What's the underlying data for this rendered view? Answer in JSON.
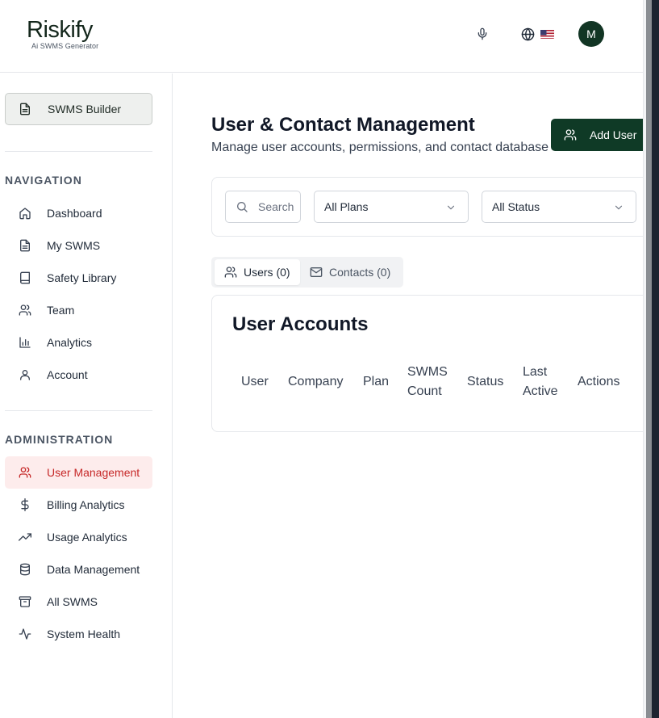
{
  "header": {
    "logo_main": "Riskify",
    "logo_sub": "Ai SWMS Generator",
    "avatar_initial": "M"
  },
  "sidebar": {
    "builder_label": "SWMS Builder",
    "nav_title": "NAVIGATION",
    "nav_items": [
      {
        "label": "Dashboard",
        "icon": "home-icon"
      },
      {
        "label": "My SWMS",
        "icon": "document-icon"
      },
      {
        "label": "Safety Library",
        "icon": "book-icon"
      },
      {
        "label": "Team",
        "icon": "users-icon"
      },
      {
        "label": "Analytics",
        "icon": "bar-chart-icon"
      },
      {
        "label": "Account",
        "icon": "user-icon"
      }
    ],
    "admin_title": "ADMINISTRATION",
    "admin_items": [
      {
        "label": "User Management",
        "icon": "users-icon",
        "active": true
      },
      {
        "label": "Billing Analytics",
        "icon": "dollar-icon"
      },
      {
        "label": "Usage Analytics",
        "icon": "trending-up-icon"
      },
      {
        "label": "Data Management",
        "icon": "database-icon"
      },
      {
        "label": "All SWMS",
        "icon": "archive-icon"
      },
      {
        "label": "System Health",
        "icon": "activity-icon"
      }
    ]
  },
  "main": {
    "title": "User & Contact Management",
    "subtitle": "Manage user accounts, permissions, and contact database",
    "add_user_label": "Add User",
    "search_placeholder": "Search",
    "plan_filter": "All Plans",
    "status_filter": "All Status",
    "tabs": [
      {
        "label": "Users (0)"
      },
      {
        "label": "Contacts (0)"
      }
    ],
    "table": {
      "title": "User Accounts",
      "headers": [
        "User",
        "Company",
        "Plan",
        "SWMS Count",
        "Status",
        "Last Active",
        "Actions"
      ]
    }
  },
  "colors": {
    "brand_dark": "#0f3a26",
    "active_red": "#c62828",
    "active_bg": "#fdecec"
  }
}
